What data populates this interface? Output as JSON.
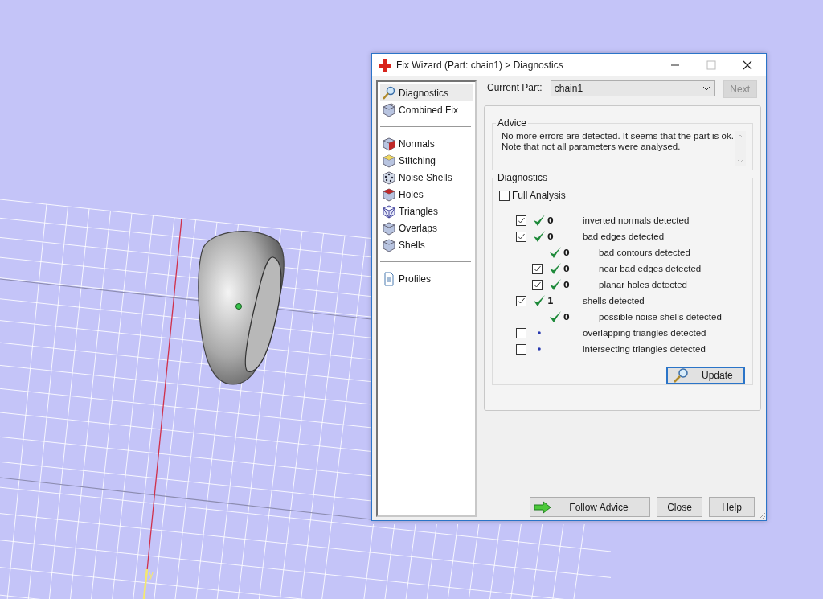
{
  "viewport": {
    "axis_label": "y"
  },
  "window": {
    "title": "Fix Wizard (Part: chain1) > Diagnostics"
  },
  "sidebar": {
    "groups": [
      [
        {
          "label": "Diagnostics",
          "selected": true
        },
        {
          "label": "Combined Fix",
          "selected": false
        }
      ],
      [
        {
          "label": "Normals",
          "selected": false
        },
        {
          "label": "Stitching",
          "selected": false
        },
        {
          "label": "Noise Shells",
          "selected": false
        },
        {
          "label": "Holes",
          "selected": false
        },
        {
          "label": "Triangles",
          "selected": false
        },
        {
          "label": "Overlaps",
          "selected": false
        },
        {
          "label": "Shells",
          "selected": false
        }
      ],
      [
        {
          "label": "Profiles",
          "selected": false
        }
      ]
    ]
  },
  "current_part": {
    "label": "Current Part:",
    "value": "chain1"
  },
  "next_button": {
    "label": "Next",
    "disabled": true
  },
  "advice": {
    "title": "Advice",
    "lines": [
      "No more errors are detected. It seems that the part is ok.",
      "Note that not all parameters were analysed."
    ]
  },
  "diagnostics": {
    "title": "Diagnostics",
    "full_analysis": {
      "label": "Full Analysis",
      "checked": false
    },
    "items": [
      {
        "checked": true,
        "count": "0",
        "label": "inverted normals detected"
      },
      {
        "checked": true,
        "count": "0",
        "label": "bad edges detected",
        "children": [
          {
            "count": "0",
            "label": "bad contours detected"
          },
          {
            "checked": true,
            "count": "0",
            "label": "near bad edges detected"
          },
          {
            "checked": true,
            "count": "0",
            "label": "planar holes detected"
          }
        ]
      },
      {
        "checked": true,
        "count": "1",
        "label": "shells detected",
        "children": [
          {
            "count": "0",
            "label": "possible noise shells detected"
          }
        ]
      },
      {
        "checked": false,
        "label": "overlapping triangles detected"
      },
      {
        "checked": false,
        "label": "intersecting triangles detected"
      }
    ]
  },
  "update_button": {
    "label": "Update"
  },
  "buttons": [
    {
      "label": "Follow Advice",
      "kind": "arrow"
    },
    {
      "label": "Close",
      "kind": "plain"
    },
    {
      "label": "Help",
      "kind": "plain"
    }
  ]
}
